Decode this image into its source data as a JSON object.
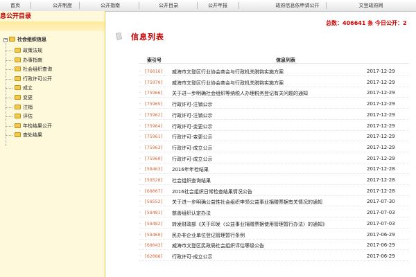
{
  "nav": [
    "首页",
    "公开制度",
    "公开指南",
    "公开目录",
    "公开年报",
    "政府信息依申请公开",
    "文登政府网"
  ],
  "sidebar": {
    "title": "息公开目录",
    "root": "社会组织信息",
    "items": [
      "政策法规",
      "办事指南",
      "社会组织查询",
      "行政许可公开",
      "成立",
      "变更",
      "注销",
      "评估",
      "年检结果公开",
      "查处结果"
    ]
  },
  "totals": "总数：406641 条  今日公开：2",
  "list_title": "信息列表",
  "columns": {
    "code": "索引号",
    "title": "信息列表"
  },
  "rows": [
    {
      "code": "[76016]",
      "title": "威海市文登区行业协会商会与行政机关脱钩实施方案",
      "date": "2017-12-29"
    },
    {
      "code": "[75970]",
      "title": "威海市文登区行业协会商会与行政机关脱钩实施方案",
      "date": "2017-12-29"
    },
    {
      "code": "[75966]",
      "title": "关于进一步明确社会组织等纳税人办理税务登记有关问题的通知",
      "date": "2017-12-29"
    },
    {
      "code": "[75965]",
      "title": "行政许可-注销公示",
      "date": "2017-12-29"
    },
    {
      "code": "[75962]",
      "title": "行政许可-注销公示",
      "date": "2017-12-29"
    },
    {
      "code": "[75964]",
      "title": "行政许可-变更公示",
      "date": "2017-12-29"
    },
    {
      "code": "[75961]",
      "title": "行政许可-变更公示",
      "date": "2017-12-29"
    },
    {
      "code": "[75963]",
      "title": "行政许可-成立公示",
      "date": "2017-12-29"
    },
    {
      "code": "[75960]",
      "title": "行政许可-成立公示",
      "date": "2017-12-29"
    },
    {
      "code": "[58463]",
      "title": "2016年年检结果",
      "date": "2017-12-28"
    },
    {
      "code": "[59520]",
      "title": "社会组织查询结果",
      "date": "2017-12-28"
    },
    {
      "code": "[68007]",
      "title": "2016社会组织日常检查结果情况公告",
      "date": "2017-12-28"
    },
    {
      "code": "[58552]",
      "title": "关于进一步明确公益性社会组织申领公益事业捐赠票据有关情况的通知",
      "date": "2017-07-30"
    },
    {
      "code": "[58481]",
      "title": "慈善组织认定办法",
      "date": "2017-07-03"
    },
    {
      "code": "[58482]",
      "title": "转发财政部《关于印发〈公益事业捐赠票据使用管理暂行办法〉的通知》",
      "date": "2017-07-03"
    },
    {
      "code": "[58460]",
      "title": "民办非企业单位登记管理暂行条例",
      "date": "2017-06-29"
    },
    {
      "code": "[68043]",
      "title": "威海市文登区民政局社会组织评估等级公告",
      "date": "2017-06-29"
    },
    {
      "code": "[62088]",
      "title": "行政许可-成立公示",
      "date": "2017-06-29"
    }
  ]
}
